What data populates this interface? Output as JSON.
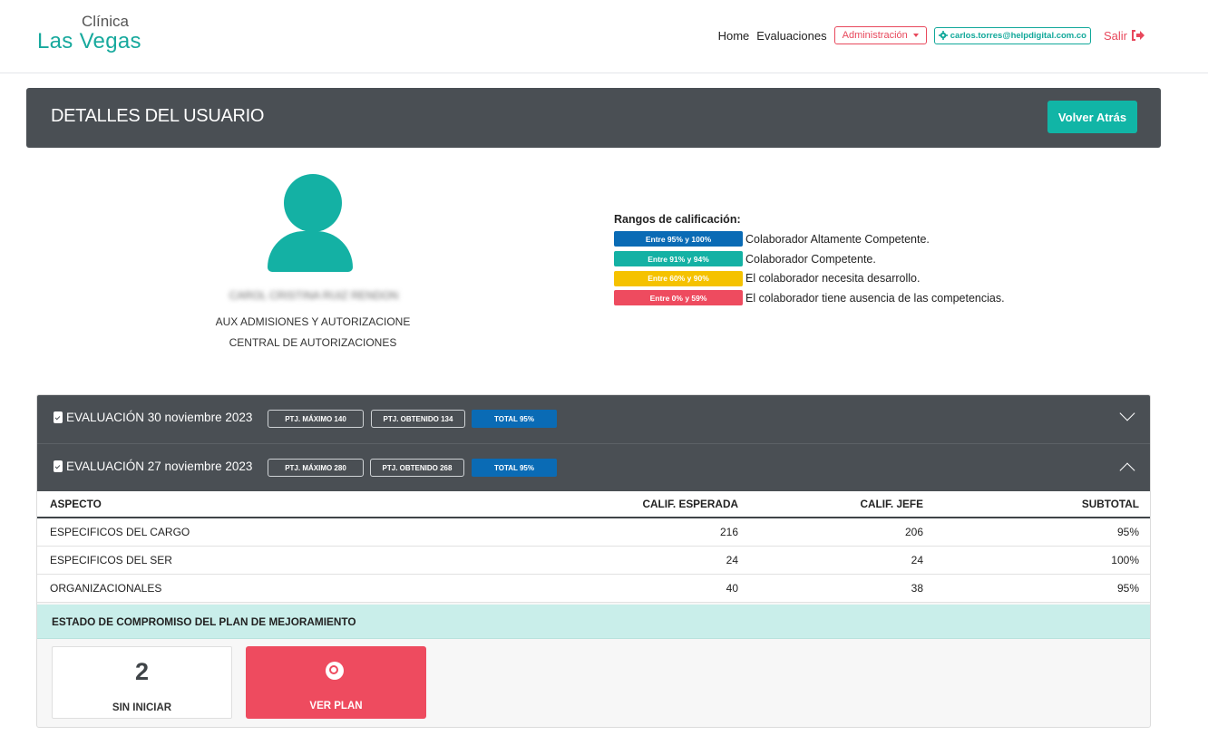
{
  "brand": {
    "line1": "Clínica",
    "line2": "Las Vegas",
    "color": "#17a99d"
  },
  "nav": {
    "home": "Home",
    "evaluaciones": "Evaluaciones",
    "admin": "Administración",
    "user_email": "carlos.torres@helpdigital.com.co",
    "salir": "Salir"
  },
  "header": {
    "title": "DETALLES DEL USUARIO",
    "back_button": "Volver Atrás"
  },
  "profile": {
    "name": "CAROL CRISTINA RUIZ RENDON",
    "role": "AUX ADMISIONES Y AUTORIZACIONE",
    "area": "CENTRAL DE AUTORIZACIONES"
  },
  "rangos": {
    "title": "Rangos de calificación:",
    "items": [
      {
        "range": "Entre 95% y 100%",
        "label": "Colaborador Altamente Competente.",
        "color": "#0a6bb5"
      },
      {
        "range": "Entre 91% y 94%",
        "label": "Colaborador Competente.",
        "color": "#14b1a4"
      },
      {
        "range": "Entre 60% y 90%",
        "label": "El colaborador necesita desarrollo.",
        "color": "#f5c200"
      },
      {
        "range": "Entre 0% y 59%",
        "label": "El colaborador tiene ausencia de las competencias.",
        "color": "#ee4b5f"
      }
    ]
  },
  "evaluaciones": [
    {
      "title": "EVALUACIÓN 30 noviembre 2023",
      "max": "PTJ. MÁXIMO 140",
      "obtenido": "PTJ. OBTENIDO 134",
      "total": "TOTAL 95%",
      "expanded": false
    },
    {
      "title": "EVALUACIÓN 27 noviembre 2023",
      "max": "PTJ. MÁXIMO 280",
      "obtenido": "PTJ. OBTENIDO 268",
      "total": "TOTAL 95%",
      "expanded": true
    }
  ],
  "table": {
    "headers": [
      "ASPECTO",
      "CALIF. ESPERADA",
      "CALIF. JEFE",
      "SUBTOTAL"
    ],
    "rows": [
      [
        "ESPECIFICOS DEL CARGO",
        "216",
        "206",
        "95%"
      ],
      [
        "ESPECIFICOS DEL SER",
        "24",
        "24",
        "100%"
      ],
      [
        "ORGANIZACIONALES",
        "40",
        "38",
        "95%"
      ]
    ]
  },
  "estado": {
    "title": "ESTADO DE COMPROMISO DEL PLAN DE MEJORAMIENTO",
    "count": "2",
    "count_label": "SIN INICIAR",
    "plan_button": "VER PLAN"
  }
}
